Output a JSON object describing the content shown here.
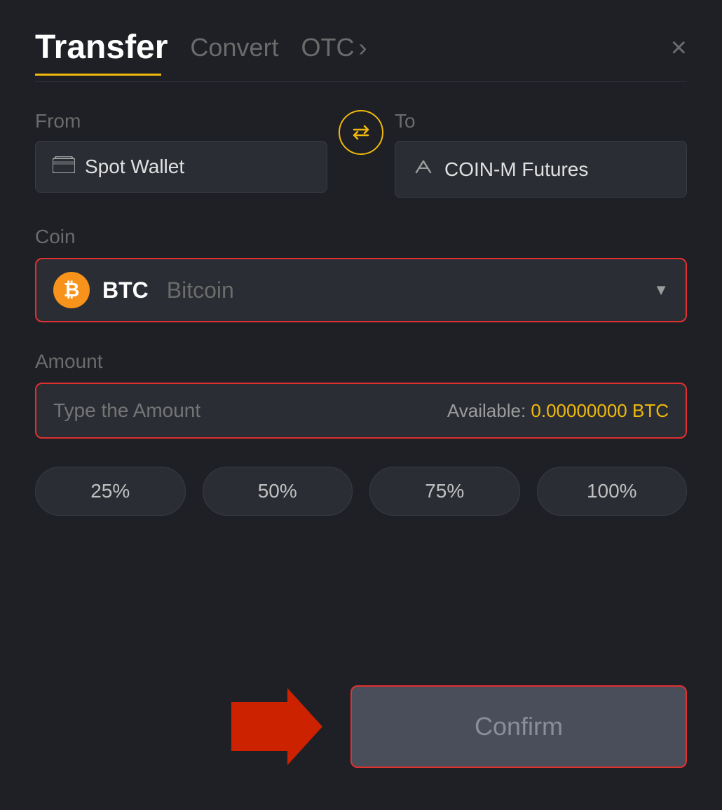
{
  "header": {
    "title": "Transfer",
    "tab_convert": "Convert",
    "tab_otc": "OTC",
    "close_label": "×"
  },
  "from": {
    "label": "From",
    "wallet_label": "Spot Wallet"
  },
  "to": {
    "label": "To",
    "wallet_label": "COIN-M Futures"
  },
  "coin": {
    "label": "Coin",
    "symbol": "BTC",
    "full_name": "Bitcoin"
  },
  "amount": {
    "label": "Amount",
    "placeholder": "Type the Amount",
    "available_label": "Available:",
    "available_value": "0.00000000 BTC"
  },
  "percentages": [
    {
      "label": "25%"
    },
    {
      "label": "50%"
    },
    {
      "label": "75%"
    },
    {
      "label": "100%"
    }
  ],
  "confirm_btn": "Confirm"
}
